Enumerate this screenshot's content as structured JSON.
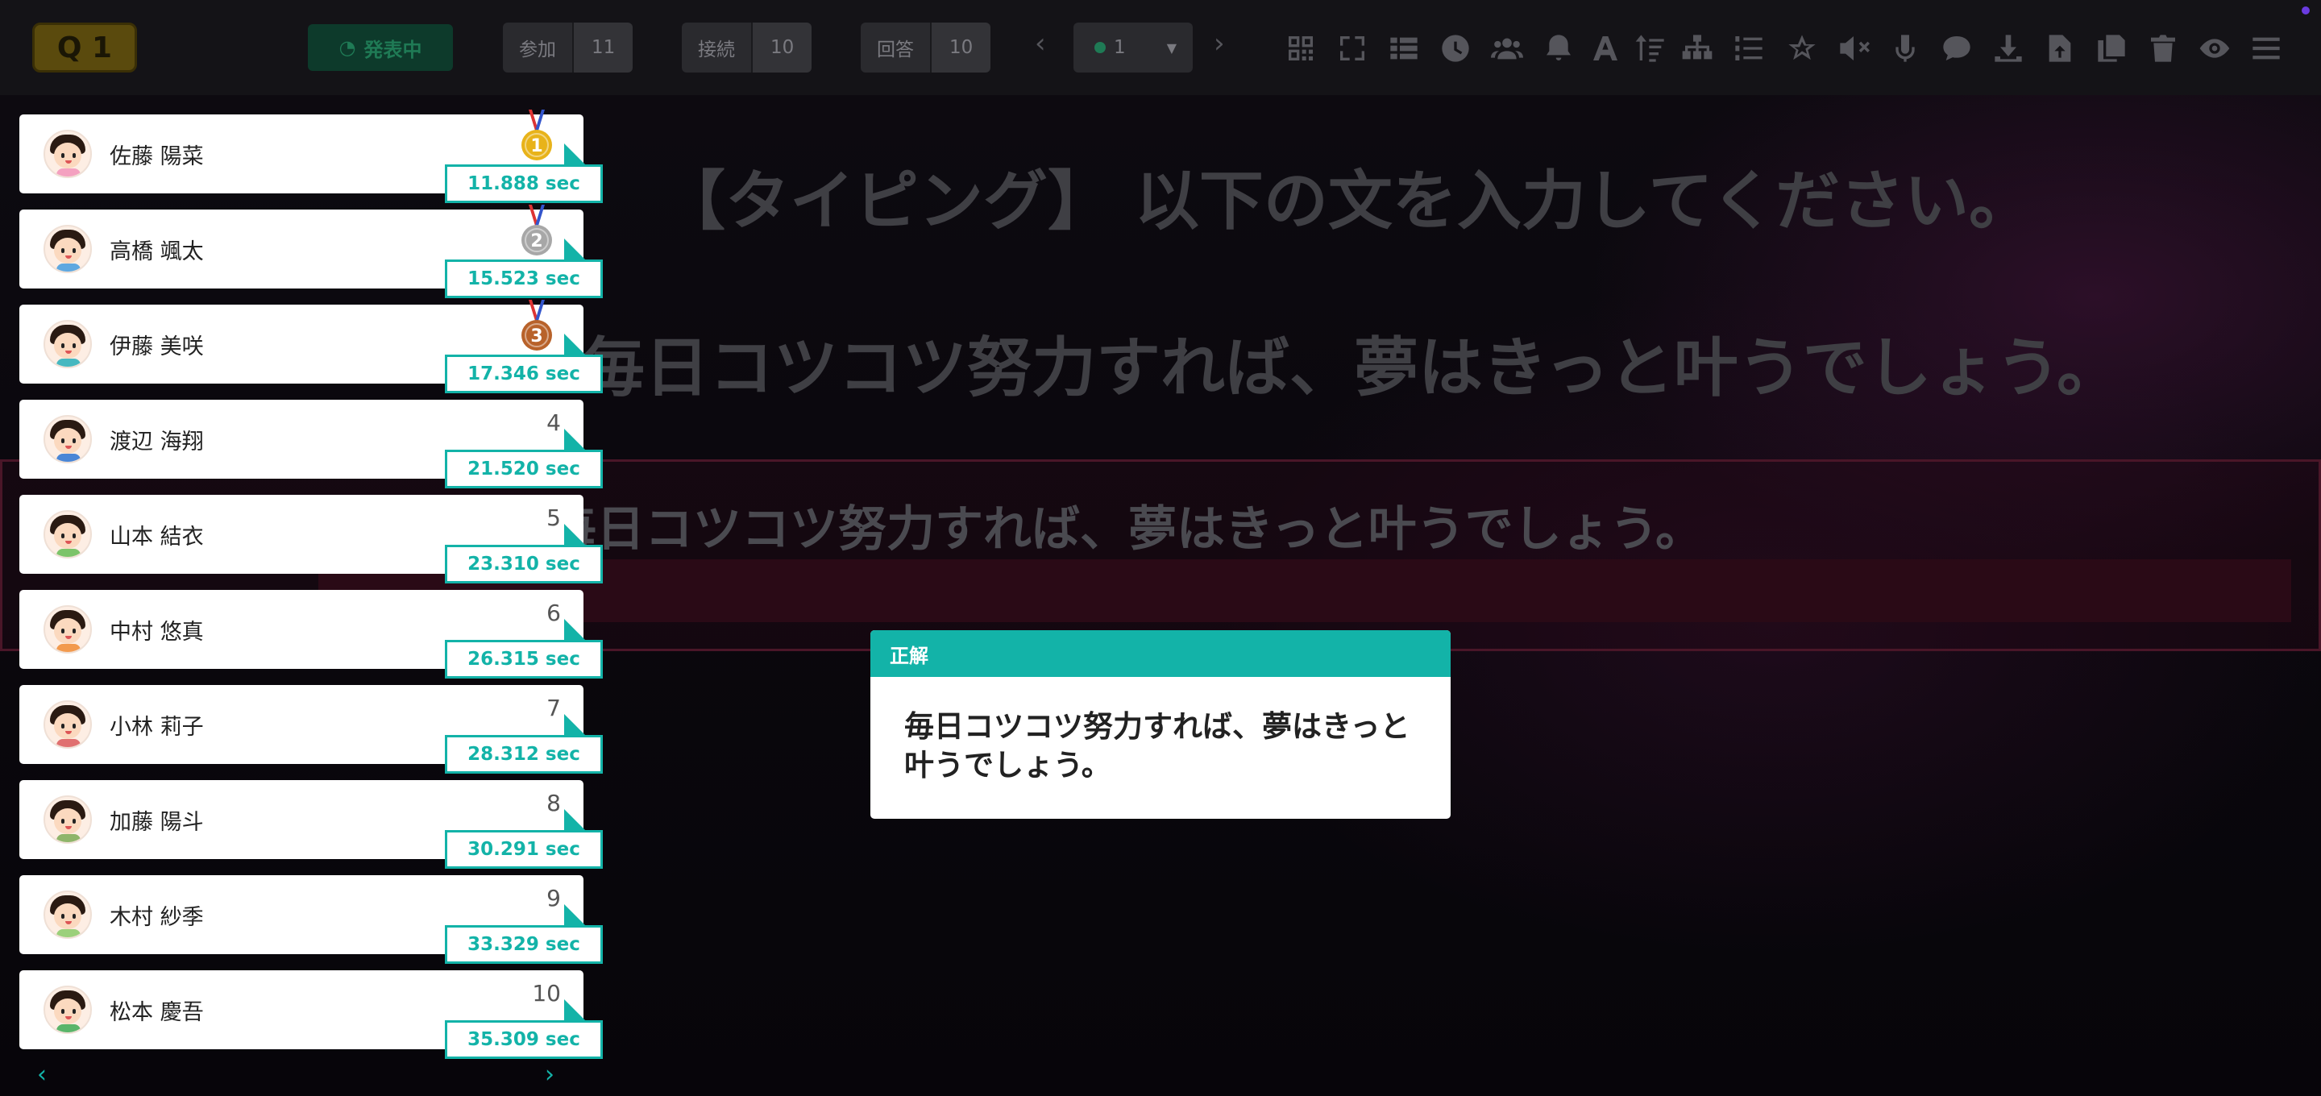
{
  "topbar": {
    "question_badge": "Q 1",
    "publish_label": "発表中",
    "stats": [
      {
        "label": "参加",
        "value": "11"
      },
      {
        "label": "接続",
        "value": "10"
      },
      {
        "label": "回答",
        "value": "10"
      }
    ],
    "page_select_value": "1",
    "prev_arrow": "‹",
    "next_arrow": "›"
  },
  "stage": {
    "question_title": "【タイピング】 以下の文を入力してください。",
    "question_text": "毎日コツコツ努力すれば、夢はきっと叶うでしょう。",
    "answer_display": "毎日コツコツ努力すれば、夢はきっと叶うでしょう。"
  },
  "ranking": [
    {
      "name": "佐藤 陽菜",
      "rank": "1",
      "time": "11.888 sec",
      "medal": "gold"
    },
    {
      "name": "高橋 颯太",
      "rank": "2",
      "time": "15.523 sec",
      "medal": "silver"
    },
    {
      "name": "伊藤 美咲",
      "rank": "3",
      "time": "17.346 sec",
      "medal": "bronze"
    },
    {
      "name": "渡辺 海翔",
      "rank": "4",
      "time": "21.520 sec"
    },
    {
      "name": "山本 結衣",
      "rank": "5",
      "time": "23.310 sec"
    },
    {
      "name": "中村 悠真",
      "rank": "6",
      "time": "26.315 sec"
    },
    {
      "name": "小林 莉子",
      "rank": "7",
      "time": "28.312 sec"
    },
    {
      "name": "加藤 陽斗",
      "rank": "8",
      "time": "30.291 sec"
    },
    {
      "name": "木村 紗季",
      "rank": "9",
      "time": "33.329 sec"
    },
    {
      "name": "松本 慶吾",
      "rank": "10",
      "time": "35.309 sec"
    }
  ],
  "ranking_nav": {
    "prev": "‹",
    "next": "›"
  },
  "correct_popup": {
    "header": "正解",
    "answer": "毎日コツコツ努力すれば、夢はきっと\n叶うでしょう。"
  },
  "colors": {
    "accent": "#13b3a8",
    "gold": "#e8b31a",
    "silver": "#a7a7a7",
    "bronze": "#b8622a"
  },
  "toolbar_icons": [
    "qr-code-icon",
    "fullscreen-icon",
    "list-view-icon",
    "clock-icon",
    "participants-icon",
    "bell-icon",
    "font-icon",
    "sort-icon",
    "hierarchy-icon",
    "numbered-list-icon",
    "star-icon",
    "mute-icon",
    "microphone-icon",
    "chat-icon",
    "download-icon",
    "upload-icon",
    "copy-icon",
    "trash-icon",
    "eye-icon",
    "menu-icon"
  ]
}
